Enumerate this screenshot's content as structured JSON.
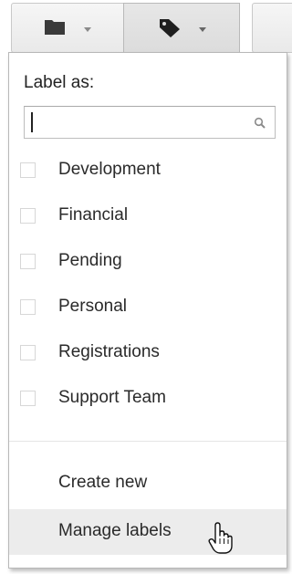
{
  "toolbar": {
    "buttons": [
      {
        "name": "move-to-folder",
        "icon": "folder-icon"
      },
      {
        "name": "labels",
        "icon": "tag-icon"
      }
    ]
  },
  "menu": {
    "title": "Label as:",
    "search": {
      "value": "",
      "placeholder": ""
    },
    "labels": [
      {
        "label": "Development",
        "checked": false
      },
      {
        "label": "Financial",
        "checked": false
      },
      {
        "label": "Pending",
        "checked": false
      },
      {
        "label": "Personal",
        "checked": false
      },
      {
        "label": "Registrations",
        "checked": false
      },
      {
        "label": "Support Team",
        "checked": false
      }
    ],
    "actions": {
      "create_new": "Create new",
      "manage_labels": "Manage labels"
    },
    "hovered_action": "manage_labels"
  },
  "colors": {
    "hover_row": "#ececec",
    "icon": "#333333",
    "text": "#2a2a2a"
  }
}
